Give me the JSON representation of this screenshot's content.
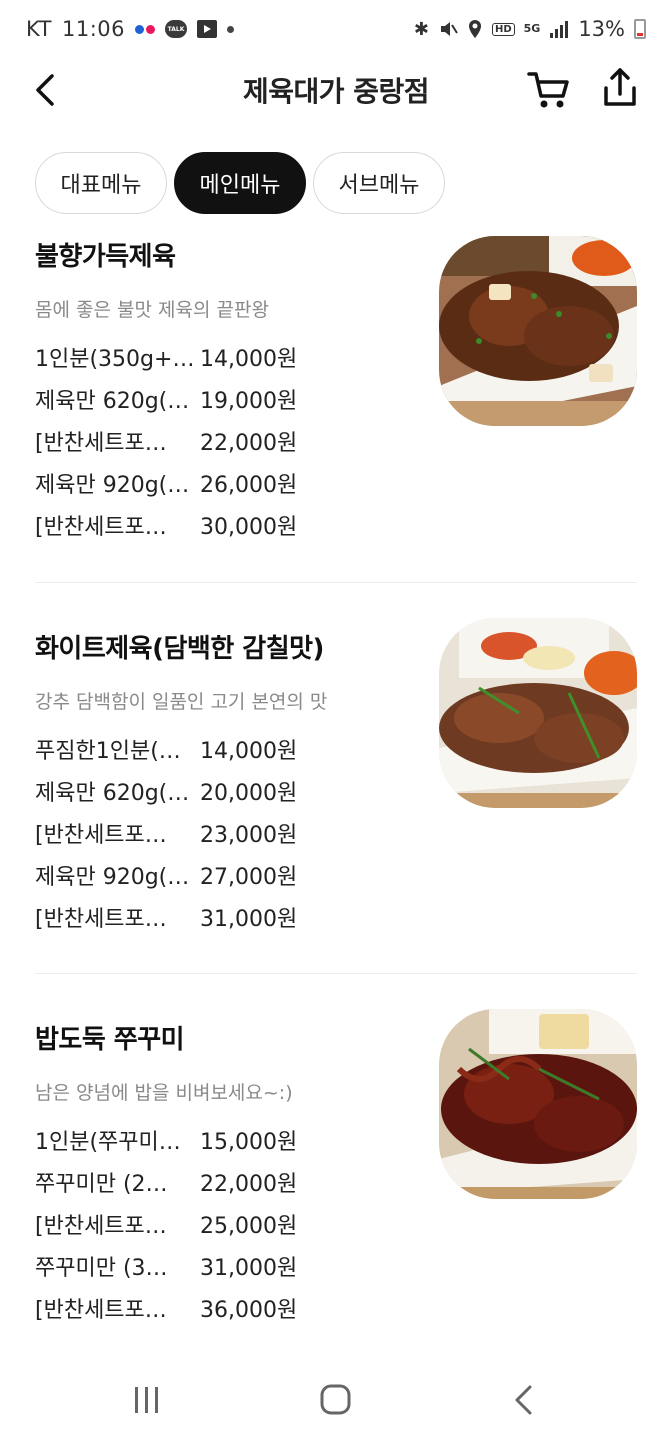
{
  "status_bar": {
    "carrier": "KT",
    "time": "11:06",
    "talk_badge": "TALK",
    "network": "5G",
    "hd_label": "HD",
    "battery_percent": "13%",
    "battery_color": "#dd3333"
  },
  "header": {
    "title": "제육대가 중랑점"
  },
  "tabs": [
    {
      "label": "대표메뉴",
      "active": false
    },
    {
      "label": "메인메뉴",
      "active": true
    },
    {
      "label": "서브메뉴",
      "active": false
    }
  ],
  "menus": [
    {
      "name": "불향가득제육",
      "description": "몸에 좋은 불맛 제육의 끝판왕",
      "options": [
        {
          "label": "1인분(350g+…",
          "price": "14,000원"
        },
        {
          "label": "제육만 620g(…",
          "price": "19,000원"
        },
        {
          "label": "[반찬세트포…",
          "price": "22,000원"
        },
        {
          "label": "제육만 920g(…",
          "price": "26,000원"
        },
        {
          "label": "[반찬세트포…",
          "price": "30,000원"
        }
      ]
    },
    {
      "name": "화이트제육(담백한 감칠맛)",
      "description": "강추 담백함이 일품인 고기 본연의 맛",
      "options": [
        {
          "label": "푸짐한1인분(…",
          "price": "14,000원"
        },
        {
          "label": "제육만 620g(…",
          "price": "20,000원"
        },
        {
          "label": "[반찬세트포…",
          "price": "23,000원"
        },
        {
          "label": "제육만 920g(…",
          "price": "27,000원"
        },
        {
          "label": "[반찬세트포…",
          "price": "31,000원"
        }
      ]
    },
    {
      "name": "밥도둑 쭈꾸미",
      "description": "남은 양념에 밥을 비벼보세요~:)",
      "options": [
        {
          "label": "1인분(쭈꾸미…",
          "price": "15,000원"
        },
        {
          "label": "쭈꾸미만 (2…",
          "price": "22,000원"
        },
        {
          "label": "[반찬세트포…",
          "price": "25,000원"
        },
        {
          "label": "쭈꾸미만 (3…",
          "price": "31,000원"
        },
        {
          "label": "[반찬세트포…",
          "price": "36,000원"
        }
      ]
    }
  ],
  "icons": {
    "back": "back-arrow-icon",
    "cart": "cart-icon",
    "share": "share-icon",
    "nav_recents": "recents-icon",
    "nav_home": "home-icon",
    "nav_back": "nav-back-icon"
  }
}
